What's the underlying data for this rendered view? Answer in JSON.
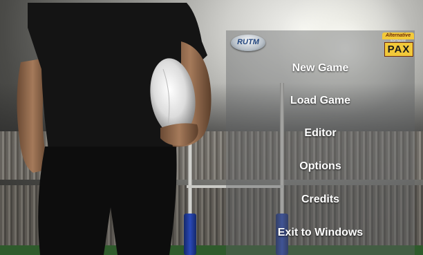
{
  "menu": {
    "items": [
      {
        "label": "New Game"
      },
      {
        "label": "Load Game"
      },
      {
        "label": "Editor"
      },
      {
        "label": "Options"
      },
      {
        "label": "Credits"
      },
      {
        "label": "Exit to Windows"
      }
    ]
  },
  "logos": {
    "left_text": "RUTM",
    "right_top": "Alternative",
    "right_sub": "SOFTWARE",
    "right_box": "PAX"
  },
  "colors": {
    "menu_text": "#ffffff",
    "panel": "#5f6264",
    "goal_pad": "#2a49b8",
    "pitch": "#2f5b2c"
  }
}
